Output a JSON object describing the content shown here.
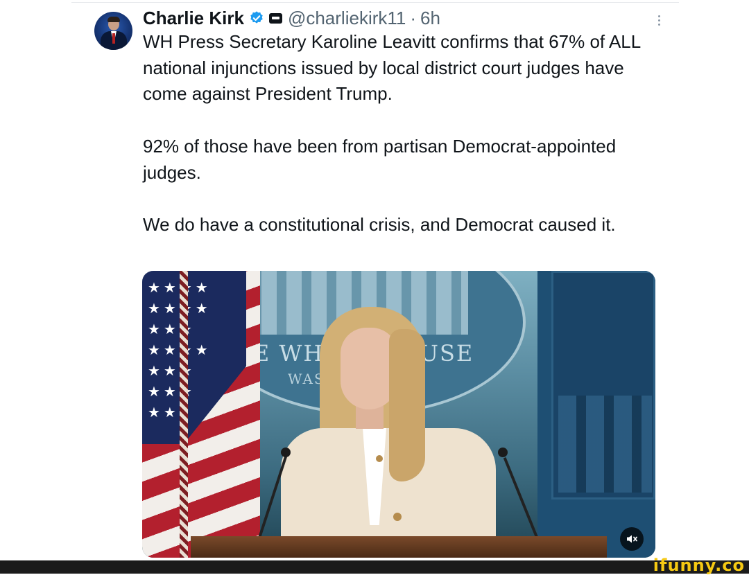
{
  "tweet": {
    "author_name": "Charlie Kirk",
    "handle": "@charliekirk11",
    "separator": "·",
    "time_ago": "6h",
    "paragraphs": [
      "WH Press Secretary Karoline Leavitt confirms that 67% of ALL national injunctions issued by local district court judges have come against President Trump.",
      "92% of those have been from partisan Democrat-appointed judges.",
      "We do have a constitutional crisis, and Democrat caused it."
    ],
    "verified_color": "#1d9bf0",
    "icons": {
      "verified": "verified-badge-icon",
      "affiliation": "affiliation-badge-icon",
      "more": "more-options-icon",
      "volume": "volume-icon"
    }
  },
  "media": {
    "backdrop_text_line1_left": "HE  WHI",
    "backdrop_text_line1_right": "USE",
    "backdrop_text_line2": "WASH"
  },
  "watermark": {
    "text": "ifunny.co",
    "color": "#f6c913"
  }
}
